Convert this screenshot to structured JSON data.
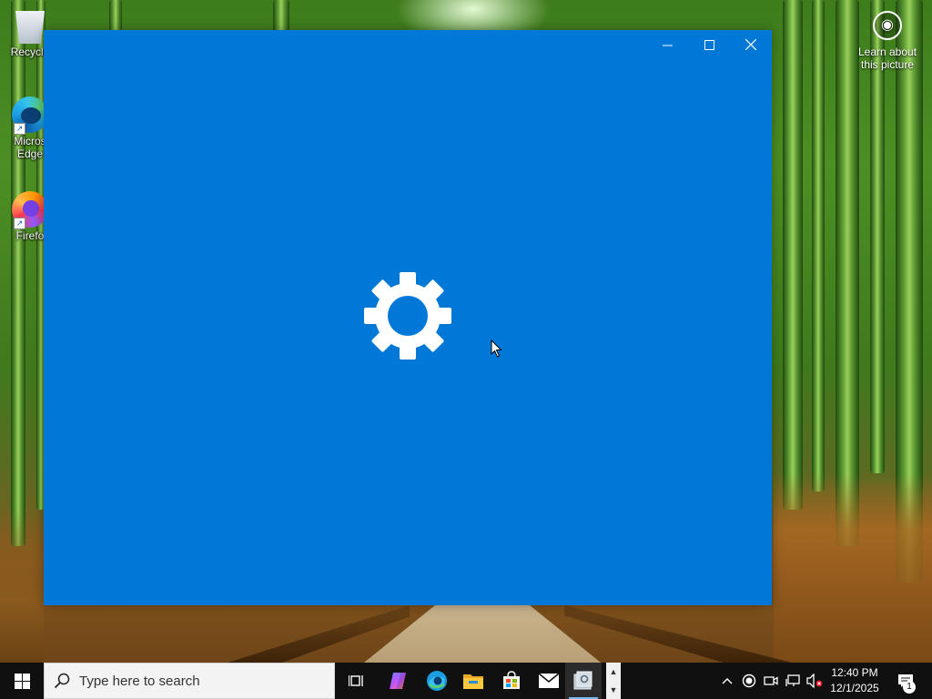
{
  "desktop": {
    "icons": [
      {
        "label": "Recycle",
        "icon": "recycle-bin-icon"
      },
      {
        "label": "Micros\nEdge",
        "icon": "edge-icon"
      },
      {
        "label": "Firefo",
        "icon": "firefox-icon"
      }
    ],
    "spotlight_label": "Learn about this picture"
  },
  "window": {
    "background_color": "#0078d7",
    "icon": "gear-icon"
  },
  "taskbar": {
    "search_placeholder": "Type here to search",
    "apps": [
      "task-view-icon",
      "copilot-icon",
      "edge-icon",
      "file-explorer-icon",
      "store-icon",
      "mail-icon",
      "settings-app-icon"
    ],
    "clock": {
      "time": "12:40 PM",
      "date": "12/1/2025"
    },
    "notification_count": "1"
  }
}
